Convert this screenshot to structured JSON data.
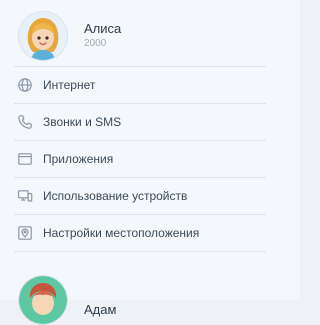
{
  "profiles": [
    {
      "name": "Алиса",
      "subtitle": "2000"
    },
    {
      "name": "Адам"
    }
  ],
  "menu": {
    "items": [
      {
        "label": "Интернет",
        "icon": "globe-icon"
      },
      {
        "label": "Звонки и SMS",
        "icon": "phone-icon"
      },
      {
        "label": "Приложения",
        "icon": "app-window-icon"
      },
      {
        "label": "Использование устройств",
        "icon": "devices-icon"
      },
      {
        "label": "Настройки местоположения",
        "icon": "location-pin-icon"
      }
    ]
  },
  "colors": {
    "background": "#f4f7fb",
    "divider": "#dde4ec",
    "icon": "#8a96a6"
  }
}
